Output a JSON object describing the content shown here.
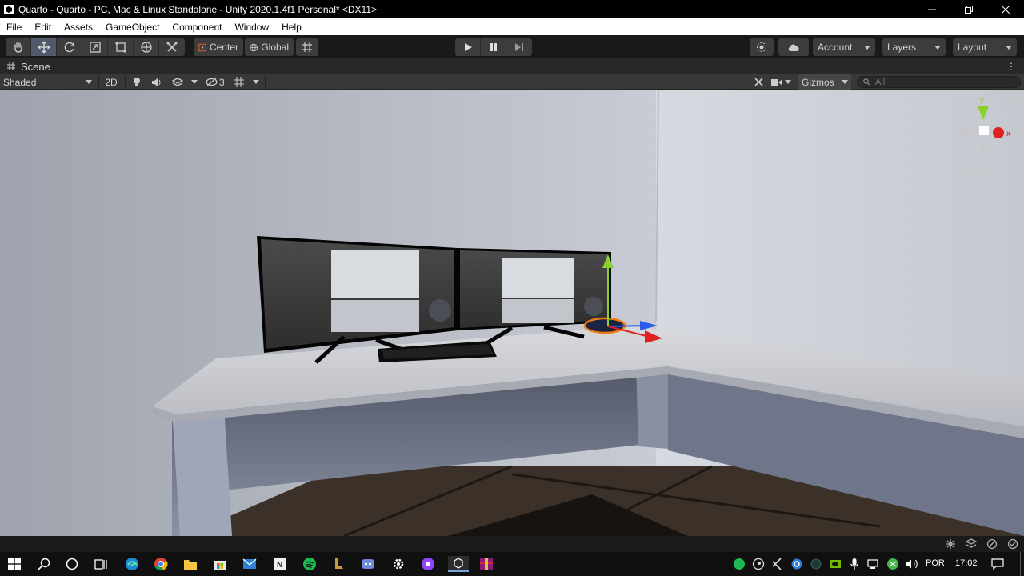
{
  "window": {
    "title": "Quarto - Quarto - PC, Mac & Linux Standalone - Unity 2020.1.4f1 Personal* <DX11>",
    "minimize_icon": "minimize-icon",
    "maximize_icon": "restore-icon",
    "close_icon": "close-icon"
  },
  "menu": [
    "File",
    "Edit",
    "Assets",
    "GameObject",
    "Component",
    "Window",
    "Help"
  ],
  "toolbar": {
    "tools": [
      "hand-tool-icon",
      "move-tool-icon",
      "rotate-tool-icon",
      "scale-tool-icon",
      "rect-tool-icon",
      "transform-tool-icon",
      "custom-tool-icon"
    ],
    "active_tool": "move-tool-icon",
    "pivot_label": "Center",
    "space_label": "Global",
    "play_icon": "play-icon",
    "pause_icon": "pause-icon",
    "step_icon": "step-icon",
    "account_label": "Account",
    "layers_label": "Layers",
    "layout_label": "Layout"
  },
  "scene_tab": {
    "label": "Scene"
  },
  "scene_toolbar": {
    "draw_mode": "Shaded",
    "mode_2d": "2D",
    "hidden_count": "3",
    "gizmos_label": "Gizmos",
    "search_placeholder": "All"
  },
  "scene_gizmo": {
    "y_label": "y",
    "x_label": "x",
    "projection_label": "Persp"
  },
  "taskbar": {
    "language": "POR",
    "time": "17:02"
  },
  "colors": {
    "accent": "#505a6a",
    "gizmo_x": "#e0201e",
    "gizmo_y": "#8bd12e",
    "gizmo_z": "#2c5ce8",
    "selection_outline": "#f07a10"
  }
}
